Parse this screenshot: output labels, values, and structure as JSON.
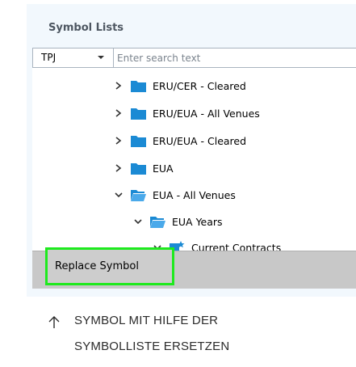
{
  "panel": {
    "title": "Symbol Lists"
  },
  "toolbar": {
    "combo_value": "TPJ",
    "search_placeholder": "Enter search text"
  },
  "tree": {
    "items": [
      {
        "label": "ERU/CER - Cleared",
        "expanded": false,
        "icon": "folder-icon"
      },
      {
        "label": "ERU/EUA - All Venues",
        "expanded": false,
        "icon": "folder-icon"
      },
      {
        "label": "ERU/EUA - Cleared",
        "expanded": false,
        "icon": "folder-icon"
      },
      {
        "label": "EUA",
        "expanded": false,
        "icon": "folder-icon"
      },
      {
        "label": "EUA - All Venues",
        "expanded": true,
        "icon": "folder-open-icon"
      },
      {
        "label": "EUA Years",
        "expanded": true,
        "icon": "folder-open-icon"
      },
      {
        "label": "Current Contracts",
        "expanded": true,
        "icon": "star-list-icon"
      }
    ]
  },
  "bottom": {
    "replace_label": "Replace Symbol"
  },
  "caption": {
    "line1": "SYMBOL MIT HILFE DER",
    "line2": "SYMBOLLISTE ERSETZEN"
  },
  "colors": {
    "panel_bg": "#f2f8fd",
    "folder": "#1b8ad4",
    "highlight_border": "#1eea1e",
    "bottom_bar": "#c8c8c8"
  }
}
